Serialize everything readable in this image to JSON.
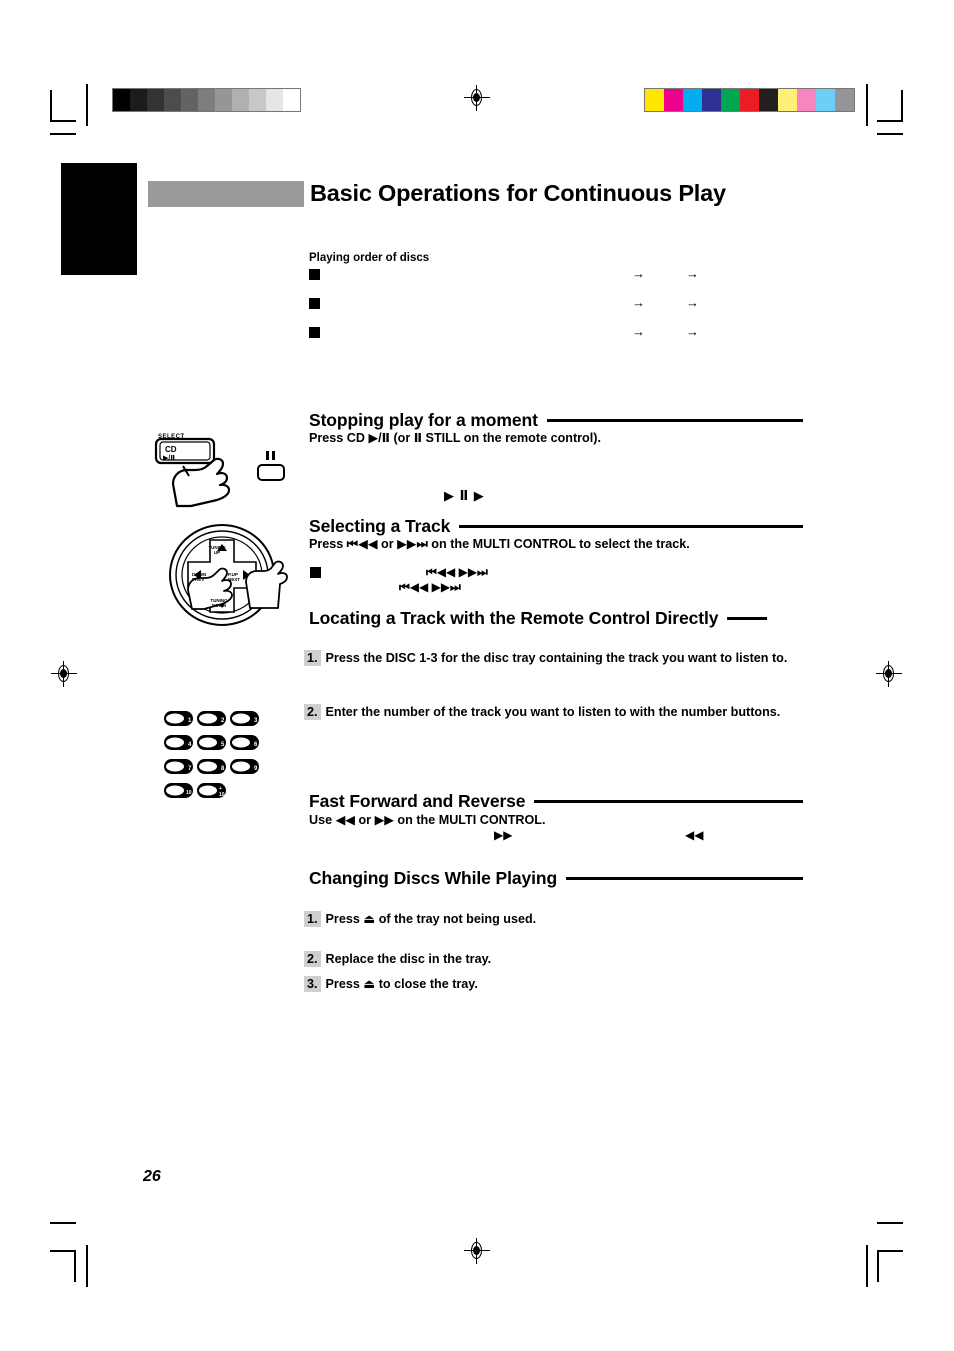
{
  "page": {
    "number": "26",
    "title": "Basic Operations for Continuous Play"
  },
  "playing_order": {
    "label": "Playing order of discs",
    "rows": [
      {
        "arrow1": "→",
        "arrow2": "→"
      },
      {
        "arrow1": "→",
        "arrow2": "→"
      },
      {
        "arrow1": "→",
        "arrow2": "→"
      }
    ]
  },
  "sections": [
    {
      "id": "stopping-play",
      "title": "Stopping play for a moment",
      "sub": "Press CD ▶/Ⅱ (or Ⅱ STILL on the remote control).",
      "inline_glyphs": "▶ Ⅱ    ▶"
    },
    {
      "id": "selecting-track",
      "title": "Selecting a Track",
      "sub": "Press ⏮◀◀ or ▶▶⏭ on the MULTI CONTROL to select the track.",
      "glyph_row_1": "⏮◀◀    ▶▶⏭",
      "glyph_row_2": "⏮◀◀    ▶▶⏭"
    },
    {
      "id": "locating-track",
      "title": "Locating a Track with the Remote Control Directly",
      "steps": [
        {
          "num": "1.",
          "text": "Press the DISC 1-3 for the disc tray containing the track you want to listen to."
        },
        {
          "num": "2.",
          "text": "Enter the number of the track you want to listen to with the number buttons."
        }
      ]
    },
    {
      "id": "fast-forward",
      "title": "Fast Forward and Reverse",
      "sub": "Use ◀◀ or ▶▶ on the MULTI CONTROL.",
      "glyph_left": "▶▶",
      "glyph_right": "◀◀"
    },
    {
      "id": "changing-discs",
      "title": "Changing Discs While Playing",
      "steps": [
        {
          "num": "1.",
          "text": "Press ⏏ of the tray not being used."
        },
        {
          "num": "2.",
          "text": "Replace the disc in the tray."
        },
        {
          "num": "3.",
          "text": "Press ⏏ to close the tray."
        }
      ]
    }
  ],
  "illustrations": {
    "cd_button": {
      "select_label": "SELECT",
      "button_top": "CD",
      "button_bottom": "▶/Ⅱ"
    },
    "remote_pause_label": "Ⅱ",
    "multi_control": {
      "tuning_up": "TUNING UP",
      "tuning_down": "TUNING DOWN",
      "left_label": "DOWN PREV",
      "right_label": "P.UP NEXT"
    },
    "keypad_keys": [
      "1",
      "2",
      "3",
      "4",
      "5",
      "6",
      "7",
      "8",
      "9",
      "10",
      "+10"
    ]
  },
  "print_marks": {
    "gray_scale": [
      "#000000",
      "#1c1c1c",
      "#333333",
      "#4c4c4c",
      "#636363",
      "#7d7d7d",
      "#969696",
      "#b0b0b0",
      "#c8c8c8",
      "#e6e6e6",
      "#ffffff"
    ],
    "color_bar": [
      "#ffe600",
      "#ec008c",
      "#00aeef",
      "#2e3192",
      "#00a651",
      "#ed1c24",
      "#231f20",
      "#fff176",
      "#f786c0",
      "#6dcff6",
      "#939598"
    ]
  }
}
